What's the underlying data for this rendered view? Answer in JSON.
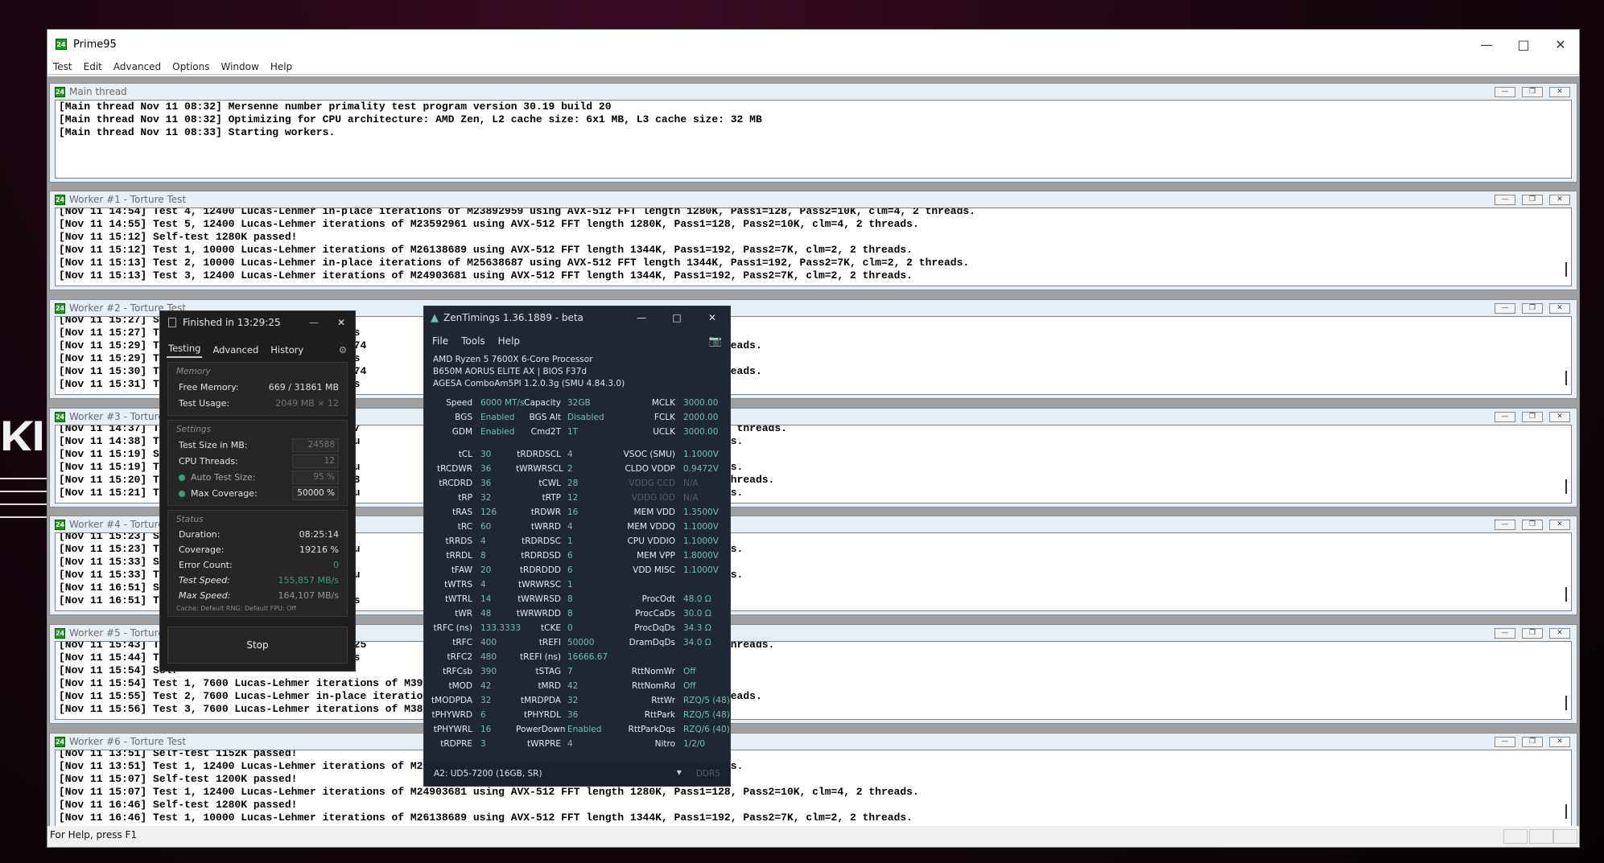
{
  "background": {
    "fragment": "KI"
  },
  "prime95": {
    "title": "Prime95",
    "menu": [
      "Test",
      "Edit",
      "Advanced",
      "Options",
      "Window",
      "Help"
    ],
    "status": "For Help, press F1",
    "windows": [
      {
        "title": "Main thread",
        "lines": [
          "[Main thread Nov 11 08:32] Mersenne number primality test program version 30.19 build 20",
          "[Main thread Nov 11 08:32] Optimizing for CPU architecture: AMD Zen, L2 cache size: 6x1 MB, L3 cache size: 32 MB",
          "[Main thread Nov 11 08:33] Starting workers."
        ]
      },
      {
        "title": "Worker #1 - Torture Test",
        "lines": [
          "[Nov 11 14:54] Test 4, 12400 Lucas-Lehmer in-place iterations of M23892959 using AVX-512 FFT length 1280K, Pass1=128, Pass2=10K, clm=4, 2 threads.",
          "[Nov 11 14:55] Test 5, 12400 Lucas-Lehmer iterations of M23592961 using AVX-512 FFT length 1280K, Pass1=128, Pass2=10K, clm=4, 2 threads.",
          "[Nov 11 15:12] Self-test 1280K passed!",
          "[Nov 11 15:12] Test 1, 10000 Lucas-Lehmer iterations of M26138689 using AVX-512 FFT length 1344K, Pass1=192, Pass2=7K, clm=2, 2 threads.",
          "[Nov 11 15:13] Test 2, 10000 Lucas-Lehmer in-place iterations of M25638687 using AVX-512 FFT length 1344K, Pass1=192, Pass2=7K, clm=2, 2 threads.",
          "[Nov 11 15:13] Test 3, 12400 Lucas-Lehmer iterations of M24903681 using AVX-512 FFT length 1344K, Pass1=192, Pass2=7K, clm=2, 2 threads."
        ]
      },
      {
        "title": "Worker #2 - Torture Test",
        "lines": [
          "[Nov 11 15:27] Self-                                                                                                 ",
          "[Nov 11 15:27] Test                  39151585 us                                            , 2 threads.",
          "[Nov 11 15:29] Test                  ons of M3874                                           K, clm=4, 2 threads.",
          "[Nov 11 15:29] Test                  38251583 us                                            , 2 threads.",
          "[Nov 11 15:30] Test                  ons of M3774                                           K, clm=4, 2 threads.",
          "[Nov 11 15:31] Test                  37748735 us                                            , 2 threads."
        ]
      },
      {
        "title": "Worker #3 - Torture",
        "lines": [
          "[Nov 11 14:37] Test                  ons of M267                                            =7680, clm=2, 2 threads.",
          "[Nov 11 14:38] Test                  M26138689 u                                            clm=2, 2 threads.",
          "[Nov 11 15:19] Self-",
          "[Nov 11 15:19] Test                  M29311553 u                                            clm=2, 2 threads.",
          "[Nov 11 15:20] Test                  ons of M288                                            =8K, clm=2, 2 threads.",
          "[Nov 11 15:21] Test                  M28311553 u                                            clm=2, 2 threads."
        ]
      },
      {
        "title": "Worker #4 - Torture",
        "lines": [
          "[Nov 11 15:23] Self-",
          "[Nov 11 15:23] Test                  M27738689 u                                            clm=2, 2 threads.",
          "[Nov 11 15:33] Self-",
          "[Nov 11 15:33] Test                  M29311553 u                                            clm=2, 2 threads.",
          "[Nov 11 16:51] Self-",
          "[Nov 11 16:51] Test                  33030145 us                                            m=4, 2 threads."
        ]
      },
      {
        "title": "Worker #5 - Torture",
        "lines": [
          "[Nov 11 15:43] Test                  ons of M3625                                           10K, clm=4, 2 threads.",
          "[Nov 11 15:44] Test                  35651585 us                                            , 2 threads.",
          "[Nov 11 15:54] Self-",
          "[Nov 11 15:54] Test 1, 7600 Lucas-Lehmer iterations of M39151585 us                         , 2 threads.",
          "[Nov 11 15:55] Test 2, 7600 Lucas-Lehmer in-place iterations of M3874                       K, clm=4, 2 threads.",
          "[Nov 11 15:56] Test 3, 7600 Lucas-Lehmer iterations of M38251583 us                         , 2 threads."
        ]
      },
      {
        "title": "Worker #6 - Torture Test",
        "lines": [
          "[Nov 11 13:51] Self-test 1152K passed!",
          "[Nov 11 13:51] Test 1, 12400 Lucas-Lehmer iterations of M22971521 u                         clm=2, 2 threads.",
          "[Nov 11 15:07] Self-test 1200K passed!",
          "[Nov 11 15:07] Test 1, 12400 Lucas-Lehmer iterations of M24903681 using AVX-512 FFT length 1280K, Pass1=128, Pass2=10K, clm=4, 2 threads.",
          "[Nov 11 16:46] Self-test 1280K passed!",
          "[Nov 11 16:46] Test 1, 10000 Lucas-Lehmer iterations of M26138689 using AVX-512 FFT length 1344K, Pass1=192, Pass2=7K, clm=2, 2 threads."
        ]
      }
    ]
  },
  "occt": {
    "title": "Finished in 13:29:25",
    "tabs": [
      "Testing",
      "Advanced",
      "History"
    ],
    "memory": {
      "label": "Memory",
      "free_label": "Free Memory:",
      "free_value": "669 / 31861 MB",
      "usage_label": "Test Usage:",
      "usage_value": "2049 MB × 12"
    },
    "settings": {
      "label": "Settings",
      "size_label": "Test Size in MB:",
      "size_value": "24588",
      "threads_label": "CPU Threads:",
      "threads_value": "12",
      "auto_label": "Auto Test Size:",
      "auto_value": "95 %",
      "coverage_label": "Max Coverage:",
      "coverage_value": "50000 %"
    },
    "status": {
      "label": "Status",
      "duration_label": "Duration:",
      "duration_value": "08:25:14",
      "coverage_label": "Coverage:",
      "coverage_value": "19216 %",
      "errors_label": "Error Count:",
      "errors_value": "0",
      "speed_label": "Test Speed:",
      "speed_value": "155,857 MB/s",
      "max_label": "Max Speed:",
      "max_value": "164,107 MB/s",
      "fine": "Cache: Default  RNG: Default  FPU: Off"
    },
    "stop_label": "Stop"
  },
  "zentimings": {
    "title": "ZenTimings 1.36.1889 - beta",
    "menu": [
      "File",
      "Tools",
      "Help"
    ],
    "info": [
      "AMD Ryzen 5 7600X 6-Core Processor",
      "B650M AORUS ELITE AX | BIOS F37d",
      "AGESA ComboAm5PI 1.2.0.3g (SMU 4.84.3.0)"
    ],
    "rows1": [
      [
        "Speed",
        "6000 MT/s",
        "Capacity",
        "32GB",
        "MCLK",
        "3000.00"
      ],
      [
        "BGS",
        "Enabled",
        "BGS Alt",
        "Disabled",
        "FCLK",
        "2000.00"
      ],
      [
        "GDM",
        "Enabled",
        "Cmd2T",
        "1T",
        "UCLK",
        "3000.00"
      ]
    ],
    "rows2": [
      [
        "tCL",
        "30",
        "tRDRDSCL",
        "4",
        "VSOC (SMU)",
        "1.1000V"
      ],
      [
        "tRCDWR",
        "36",
        "tWRWRSCL",
        "2",
        "CLDO VDDP",
        "0.9472V"
      ],
      [
        "tRCDRD",
        "36",
        "tCWL",
        "28",
        "VDDG CCD",
        "N/A"
      ],
      [
        "tRP",
        "32",
        "tRTP",
        "12",
        "VDDG IOD",
        "N/A"
      ],
      [
        "tRAS",
        "126",
        "tRDWR",
        "16",
        "MEM VDD",
        "1.3500V"
      ],
      [
        "tRC",
        "60",
        "tWRRD",
        "4",
        "MEM VDDQ",
        "1.1000V"
      ],
      [
        "tRRDS",
        "4",
        "tRDRDSC",
        "1",
        "CPU VDDIO",
        "1.1000V"
      ],
      [
        "tRRDL",
        "8",
        "tRDRDSD",
        "6",
        "MEM VPP",
        "1.8000V"
      ],
      [
        "tFAW",
        "20",
        "tRDRDDD",
        "6",
        "VDD MISC",
        "1.1000V"
      ],
      [
        "tWTRS",
        "4",
        "tWRWRSC",
        "1",
        "",
        ""
      ],
      [
        "tWTRL",
        "14",
        "tWRWRSD",
        "8",
        "ProcOdt",
        "48.0 Ω"
      ],
      [
        "tWR",
        "48",
        "tWRWRDD",
        "8",
        "ProcCaDs",
        "30.0 Ω"
      ],
      [
        "tRFC (ns)",
        "133.3333",
        "tCKE",
        "0",
        "ProcDqDs",
        "34.3 Ω"
      ],
      [
        "tRFC",
        "400",
        "tREFI",
        "50000",
        "DramDqDs",
        "34.0 Ω"
      ],
      [
        "tRFC2",
        "480",
        "tREFI (ns)",
        "16666.67",
        "",
        ""
      ],
      [
        "tRFCsb",
        "390",
        "tSTAG",
        "7",
        "RttNomWr",
        "Off"
      ],
      [
        "tMOD",
        "42",
        "tMRD",
        "42",
        "RttNomRd",
        "Off"
      ],
      [
        "tMODPDA",
        "32",
        "tMRDPDA",
        "32",
        "RttWr",
        "RZQ/5 (48)"
      ],
      [
        "tPHYWRD",
        "6",
        "tPHYRDL",
        "36",
        "RttPark",
        "RZQ/5 (48)"
      ],
      [
        "tPHYWRL",
        "16",
        "PowerDown",
        "Enabled",
        "RttParkDqs",
        "RZQ/6 (40)"
      ],
      [
        "tRDPRE",
        "3",
        "tWRPRE",
        "4",
        "Nitro",
        "1/2/0"
      ]
    ],
    "dimm": "A2: UD5-7200 (16GB, SR)",
    "ddr": "DDR5"
  },
  "colors": {
    "zen_value": "#6fc3ac",
    "occt_dot": "#3aa372"
  }
}
